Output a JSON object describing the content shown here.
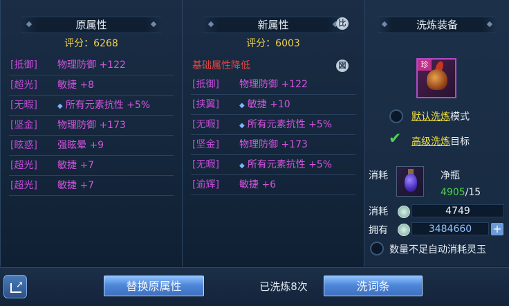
{
  "left": {
    "title": "原属性",
    "score": "评分：6268",
    "rows": [
      {
        "tag": "[抵御]",
        "value": "物理防御 +122",
        "gem": false
      },
      {
        "tag": "[超光]",
        "value": "敏捷 +8",
        "gem": false
      },
      {
        "tag": "[无暇]",
        "value": "所有元素抗性 +5%",
        "gem": true
      },
      {
        "tag": "[坚金]",
        "value": "物理防御 +173",
        "gem": false
      },
      {
        "tag": "[眩惑]",
        "value": "强眩晕 +9",
        "gem": false
      },
      {
        "tag": "[超光]",
        "value": "敏捷 +7",
        "gem": false
      },
      {
        "tag": "[超光]",
        "value": "敏捷 +7",
        "gem": false
      }
    ]
  },
  "middle": {
    "title": "新属性",
    "score": "评分：6003",
    "compare_icon": "比",
    "warning": "基础属性降低",
    "warning_icon": "図",
    "rows": [
      {
        "tag": "[抵御]",
        "value": "物理防御 +122",
        "gem": false
      },
      {
        "tag": "[挟翼]",
        "value": "敏捷 +10",
        "gem": true
      },
      {
        "tag": "[无暇]",
        "value": "所有元素抗性 +5%",
        "gem": true
      },
      {
        "tag": "[坚金]",
        "value": "物理防御 +173",
        "gem": false
      },
      {
        "tag": "[无暇]",
        "value": "所有元素抗性 +5%",
        "gem": true
      },
      {
        "tag": "[逾辉]",
        "value": "敏捷 +6",
        "gem": false
      }
    ]
  },
  "right": {
    "title": "洗炼装备",
    "item_badge": "珍",
    "option1": {
      "link": "默认洗炼",
      "suffix": "模式",
      "checked": false
    },
    "option2": {
      "link": "高级洗炼",
      "suffix": "目标",
      "checked": true
    },
    "consume_label": "消耗",
    "item_name": "净瓶",
    "item_have": "4905",
    "item_need": "/15",
    "consume_label2": "消耗",
    "jade_cost": "4749",
    "own_label": "拥有",
    "jade_own": "3484660",
    "plus": "+",
    "auto_label": "数量不足自动消耗灵玉"
  },
  "bottom": {
    "replace_button": "替换原属性",
    "count_text": "已洗炼8次",
    "refine_button": "洗词条"
  },
  "colors": {
    "tag": "#c14bd6",
    "value": "#d454e0",
    "score": "#f1d24a",
    "warning": "#e0463f",
    "have_count": "#4fd04a"
  }
}
